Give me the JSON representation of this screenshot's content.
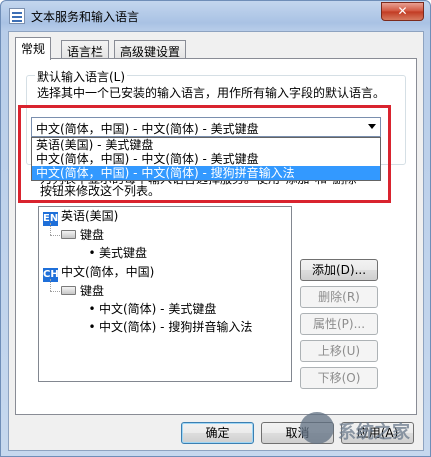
{
  "window": {
    "title": "文本服务和输入语言",
    "close_label": "✕"
  },
  "tabs": [
    {
      "label": "常规",
      "active": true
    },
    {
      "label": "语言栏",
      "active": false
    },
    {
      "label": "高级键设置",
      "active": false
    }
  ],
  "default_language": {
    "group_title": "默认输入语言(L)",
    "description": "选择其中一个已安装的输入语言，用作所有输入字段的默认语言。",
    "selected_value": "中文(简体，中国) - 中文(简体) - 美式键盘",
    "options": [
      {
        "label": "英语(美国) - 美式键盘",
        "selected": false
      },
      {
        "label": "中文(简体，中国) - 中文(简体) - 美式键盘",
        "selected": false
      },
      {
        "label": "中文(简体，中国) - 中文(简体) - 搜狗拼音输入法",
        "selected": true
      }
    ]
  },
  "installed_services": {
    "description_line1": "为列表中显示的每个输入语言选择服务。使用\"添加\"和\"删除\"",
    "description_line2": "按钮来修改这个列表。",
    "tree": {
      "english_badge": "EN",
      "english_label": "英语(美国)",
      "english_keyboard_group": "键盘",
      "english_keyboard_item": "美式键盘",
      "chinese_badge": "CH",
      "chinese_label": "中文(简体，中国)",
      "chinese_keyboard_group": "键盘",
      "chinese_item_1": "中文(简体) - 美式键盘",
      "chinese_item_2": "中文(简体) - 搜狗拼音输入法"
    }
  },
  "side_buttons": {
    "add": "添加(D)...",
    "remove": "删除(R)",
    "properties": "属性(P)...",
    "move_up": "上移(U)",
    "move_down": "下移(O)"
  },
  "footer": {
    "ok": "确定",
    "cancel": "取消",
    "apply": "应用(A)"
  },
  "watermark_text": "系统之家"
}
